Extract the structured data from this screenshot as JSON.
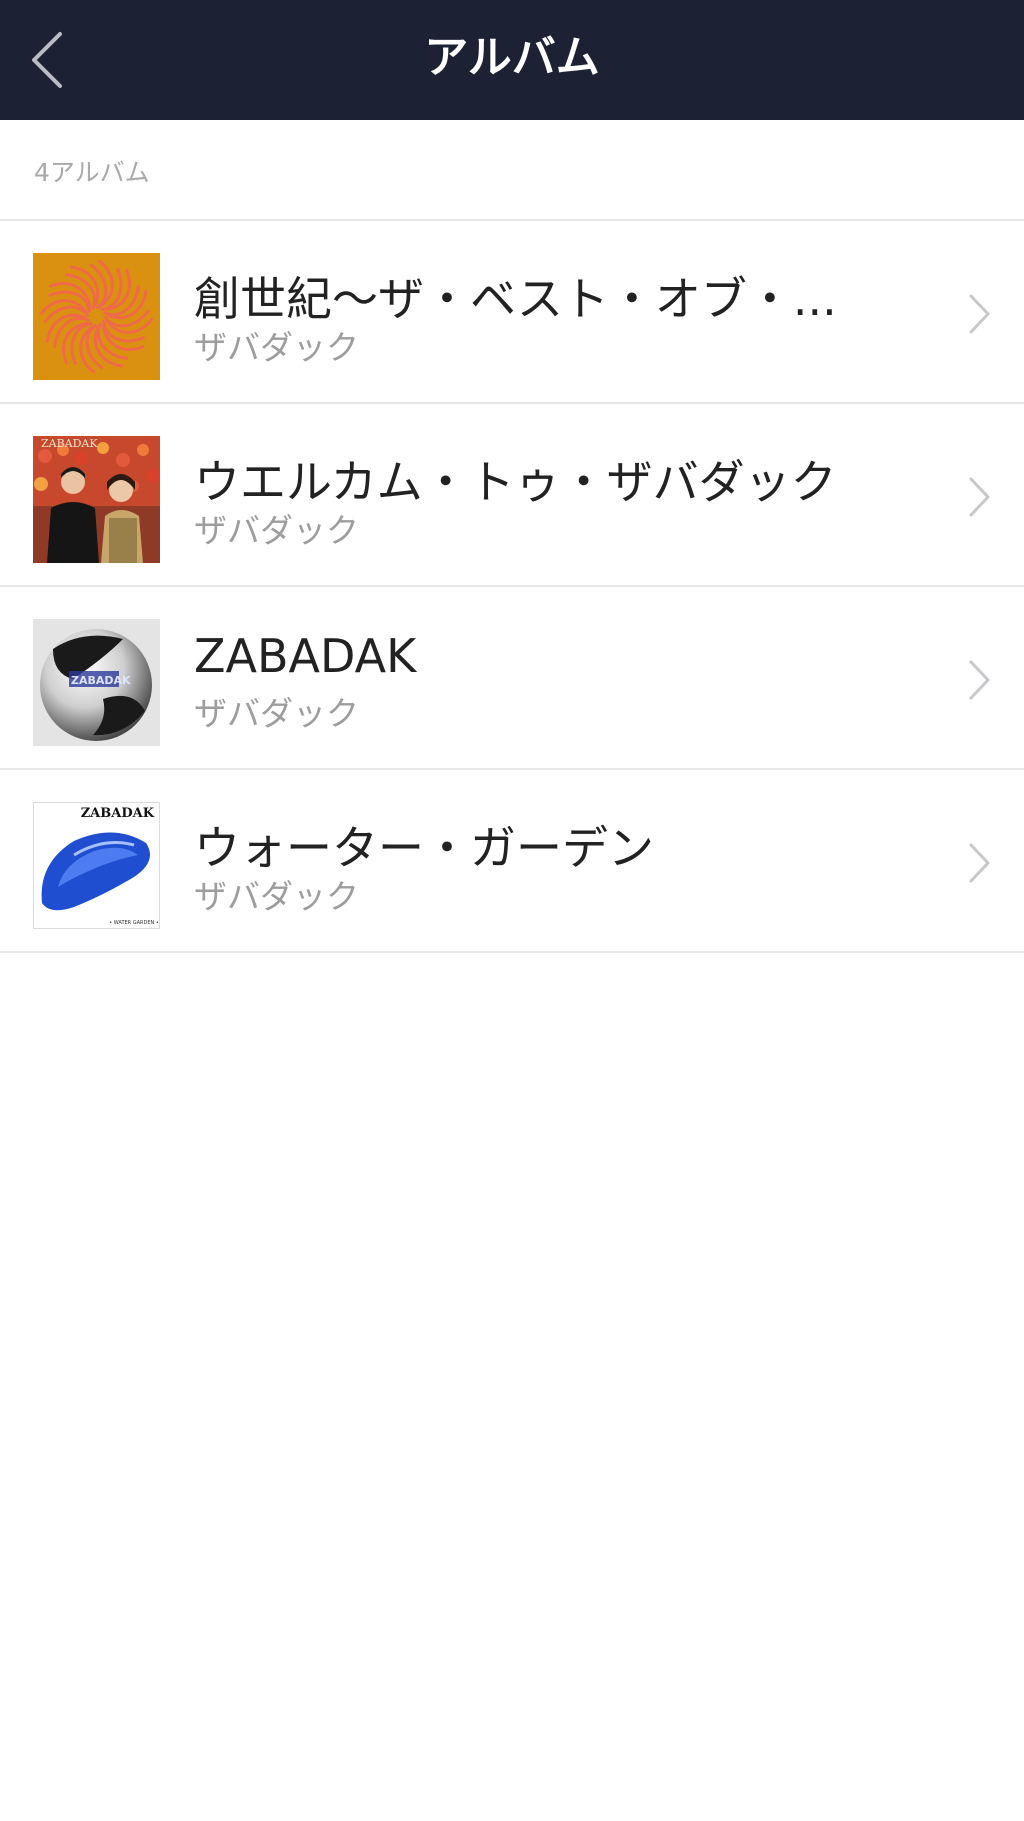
{
  "header": {
    "title": "アルバム",
    "back_icon": "chevron-left-icon"
  },
  "summary": {
    "count_label": "4アルバム"
  },
  "albums": [
    {
      "title": "創世紀〜ザ・ベスト・オブ・...",
      "artist": "ザバダック",
      "cover_icon": "album-cover-orange-spiral"
    },
    {
      "title": "ウエルカム・トゥ・ザバダック",
      "artist": "ザバダック",
      "cover_icon": "album-cover-band-photo",
      "cover_text": "ZABADAK"
    },
    {
      "title": "ZABADAK",
      "artist": "ザバダック",
      "cover_icon": "album-cover-chrome-sphere",
      "cover_text": "ZABADAK"
    },
    {
      "title": "ウォーター・ガーデン",
      "artist": "ザバダック",
      "cover_icon": "album-cover-blue-shape",
      "cover_text": "ZABADAK",
      "cover_subtext": "• WATER GARDEN •"
    }
  ],
  "colors": {
    "header_bg": "#1c2233",
    "divider": "#e6e6e6",
    "secondary_text": "#9d9d9d"
  }
}
